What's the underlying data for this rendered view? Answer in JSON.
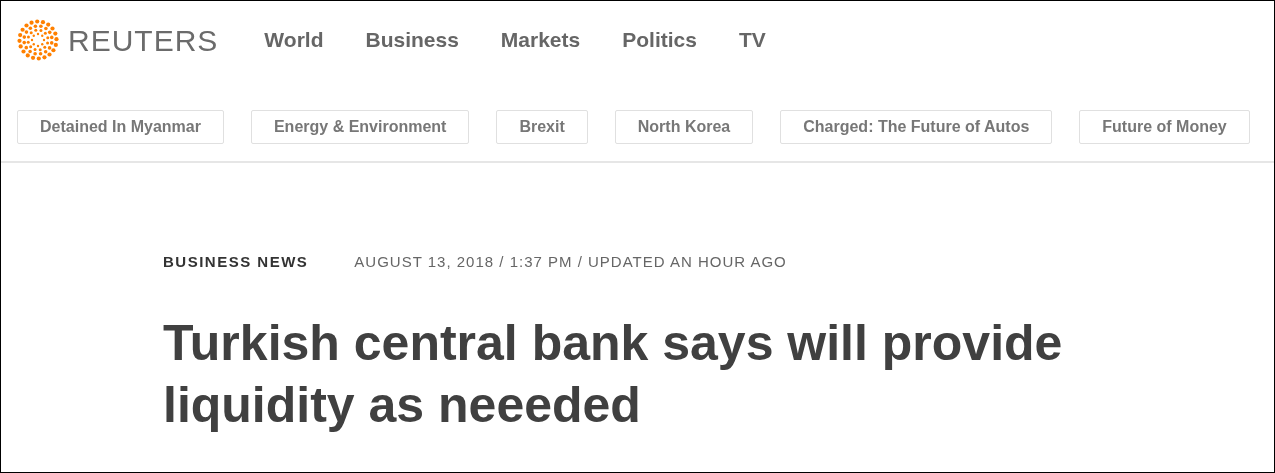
{
  "brand": {
    "name": "REUTERS"
  },
  "nav": [
    "World",
    "Business",
    "Markets",
    "Politics",
    "TV"
  ],
  "topics": [
    "Detained In Myanmar",
    "Energy & Environment",
    "Brexit",
    "North Korea",
    "Charged: The Future of Autos",
    "Future of Money"
  ],
  "article": {
    "section": "BUSINESS NEWS",
    "dateline": "AUGUST 13, 2018 / 1:37 PM / UPDATED AN HOUR AGO",
    "headline": "Turkish central bank says will provide liquidity as neeeded"
  }
}
